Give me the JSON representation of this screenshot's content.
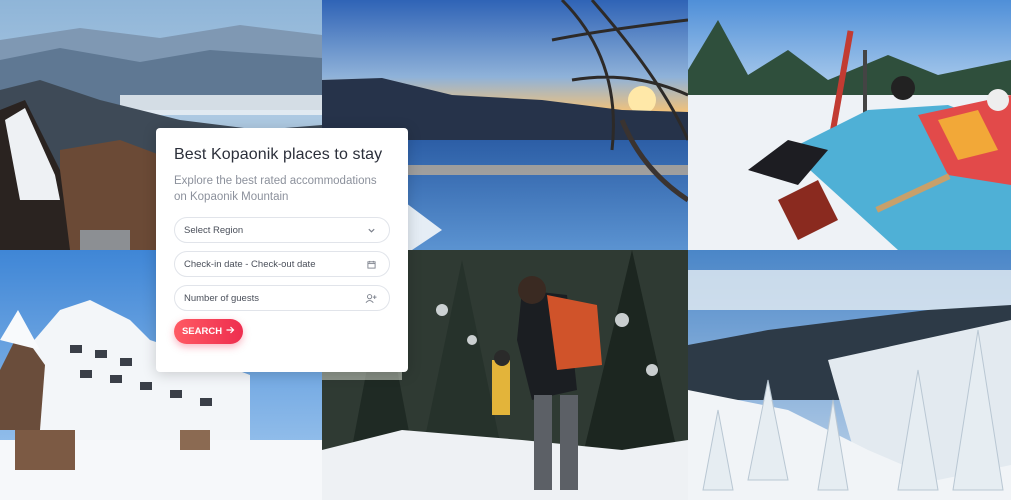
{
  "card": {
    "title": "Best Kopaonik places to stay",
    "subtitle": "Explore the best rated accommodations on Kopaonik Mountain",
    "region_select": {
      "value": "Select Region",
      "icon": "chevron-down-icon"
    },
    "dates_field": {
      "placeholder": "Check-in date - Check-out date",
      "icon": "calendar-icon"
    },
    "guests_field": {
      "placeholder": "Number of guests",
      "icon": "add-user-icon"
    },
    "search_button": {
      "label": "SEARCH",
      "icon": "arrow-right-icon"
    }
  },
  "colors": {
    "accent": "#ee2e4f",
    "title": "#2b2f3a",
    "muted": "#8c919c"
  },
  "photos": [
    {
      "subject": "snowy-mountain-range-with-chalet-roof"
    },
    {
      "subject": "sunset-over-mountain-lake"
    },
    {
      "subject": "skiers-relaxing-on-deck-chairs"
    },
    {
      "subject": "snowy-alpine-resort-hotel"
    },
    {
      "subject": "hiker-with-backpack-in-snowy-forest"
    },
    {
      "subject": "snow-covered-fir-trees-on-slope"
    }
  ]
}
